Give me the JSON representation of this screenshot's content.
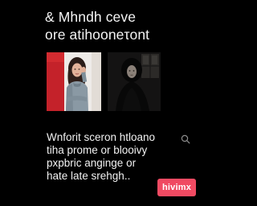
{
  "headline": {
    "line1": "& Mhndh ceve",
    "line2": "ore atihooneτont"
  },
  "photos": [
    {
      "icon": "portrait-woman-red-background"
    },
    {
      "icon": "portrait-hooded-figure-dark"
    }
  ],
  "caption": {
    "line1": "Wnforit sceron htloano",
    "line2": "tiha  prome or blooivy",
    "line3": "pxpbric  anginge or",
    "line4": "hate late srehgh.."
  },
  "search": {
    "icon": "search-icon"
  },
  "brand_button": {
    "label": "hivimx"
  },
  "colors": {
    "background": "#000000",
    "text": "#f4f4f4",
    "accent": "#f04a62",
    "photo_red": "#c4222a"
  }
}
